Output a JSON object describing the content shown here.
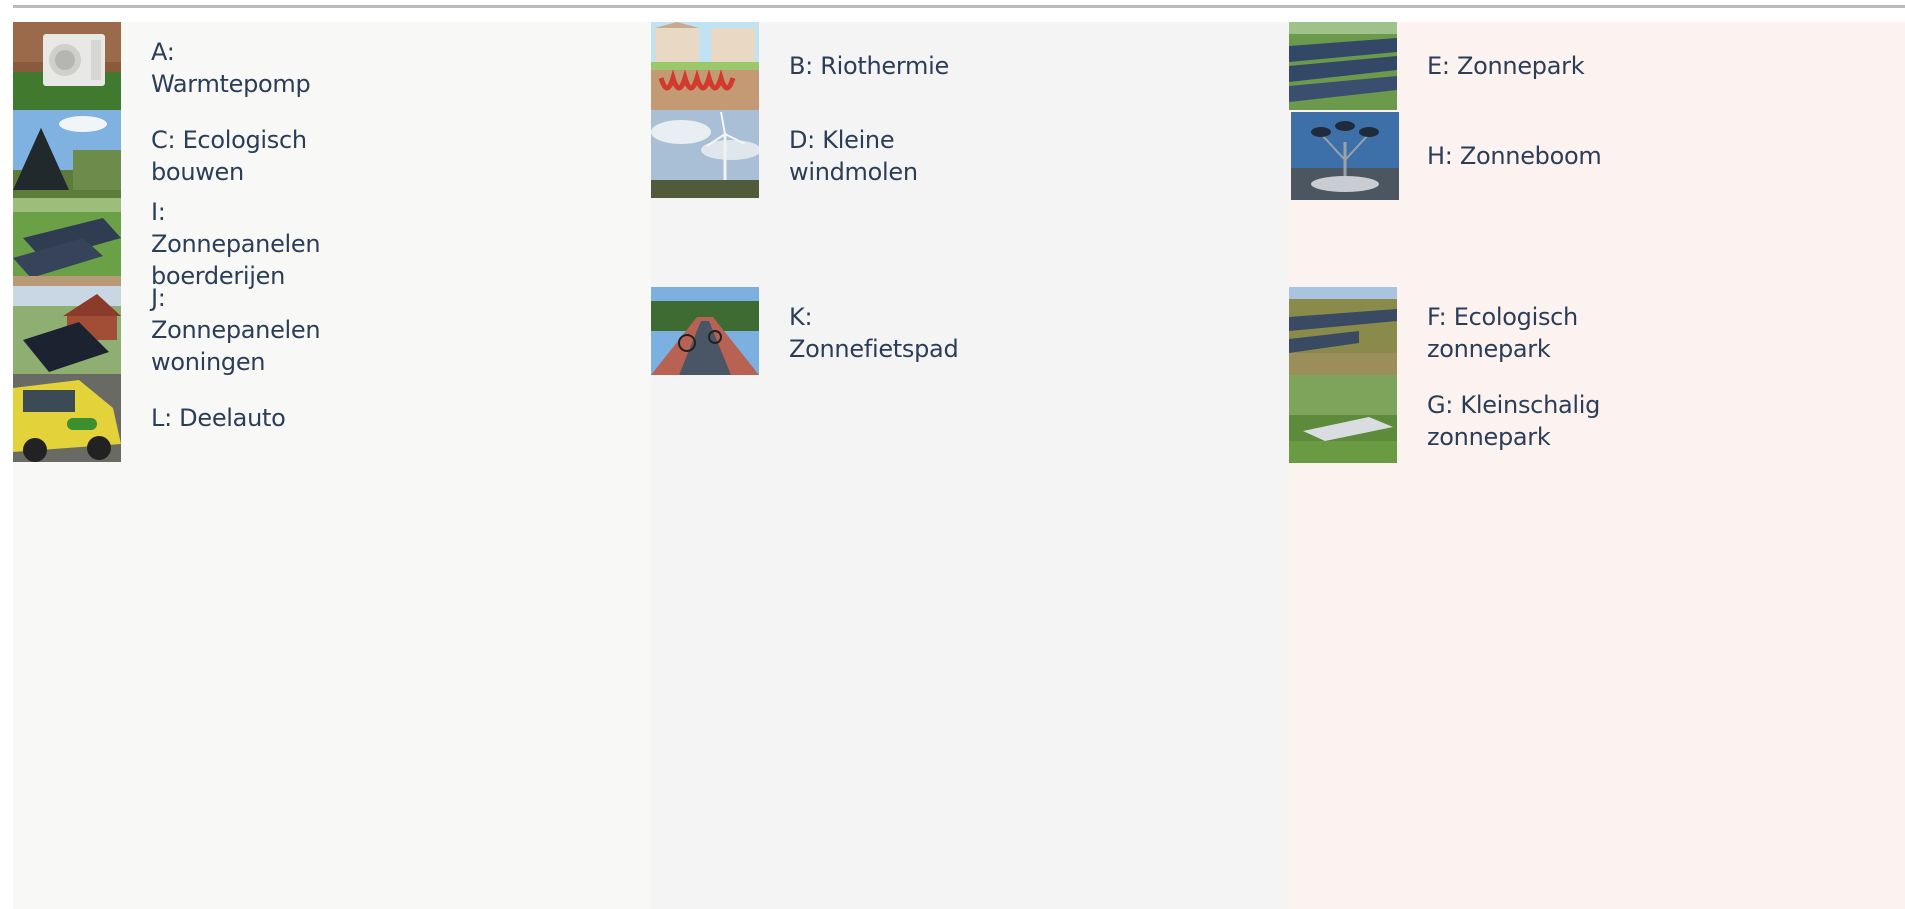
{
  "columns": [
    {
      "items": [
        {
          "label": "A:\nWarmtepomp",
          "icon": "heat-pump-photo"
        },
        {
          "label": "C: Ecologisch\nbouwen",
          "icon": "ecological-building-photo"
        },
        {
          "label": "I:\nZonnepanelen\nboerderijen",
          "icon": "farm-solar-panels-photo"
        },
        {
          "label": "J:\nZonnepanelen\nwoningen",
          "icon": "house-solar-panels-photo"
        },
        {
          "label": "L: Deelauto",
          "icon": "shared-car-photo"
        }
      ]
    },
    {
      "items": [
        {
          "label": "B: Riothermie",
          "icon": "riothermie-illustration"
        },
        {
          "label": "D: Kleine\nwindmolen",
          "icon": "small-windmill-photo"
        },
        {
          "label": "K:\nZonnefietspad",
          "icon": "solar-bike-path-photo"
        }
      ]
    },
    {
      "items": [
        {
          "label": "E: Zonnepark",
          "icon": "solar-park-photo"
        },
        {
          "label": "H: Zonneboom",
          "icon": "solar-tree-photo"
        },
        {
          "label": "F: Ecologisch\nzonnepark",
          "icon": "ecological-solar-park-photo"
        },
        {
          "label": "G: Kleinschalig\nzonnepark",
          "icon": "small-solar-park-photo"
        }
      ]
    }
  ]
}
